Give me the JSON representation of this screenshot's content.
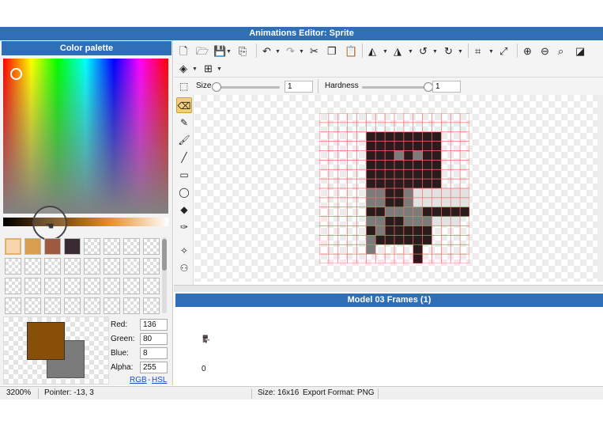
{
  "window": {
    "title": "Animations Editor: Sprite"
  },
  "palette": {
    "title": "Color palette",
    "swatches": [
      {
        "color": "#f6d6ac",
        "selected": true
      },
      {
        "color": "#d89e4e"
      },
      {
        "color": "#a05a40"
      },
      {
        "color": "#3a2a32"
      }
    ],
    "primary_color": "#884f08",
    "secondary_color": "#7b7b7b",
    "red_label": "Red:",
    "red": "136",
    "green_label": "Green:",
    "green": "80",
    "blue_label": "Blue:",
    "blue": "8",
    "alpha_label": "Alpha:",
    "alpha": "255",
    "rgb_link": "RGB",
    "separator": "-",
    "hsl_link": "HSL"
  },
  "options": {
    "size_label": "Size",
    "size_value": "1",
    "size_level": 0.0,
    "hardness_label": "Hardness",
    "hardness_value": "1",
    "hardness_level": 1.0
  },
  "frames": {
    "title": "Model 03 Frames (1)",
    "frame_number": "0"
  },
  "status": {
    "zoom": "3200%",
    "pointer": "Pointer: -13, 3",
    "size": "Size: 16x16",
    "export_format": "Export Format: PNG"
  },
  "colors": {
    "accent": "#2f6fb6",
    "active_tool": "#f3cf7b",
    "grid_line": "#ff6b6b"
  },
  "sprite": {
    "palette": {
      "0": "transparent",
      "1": "#2a1b1c",
      "2": "#7b7b7b",
      "3": "#e2e2e2"
    },
    "pixels": [
      "0000000000000000",
      "0000000000000000",
      "0000011111111000",
      "0000011111111000",
      "0000011121211000",
      "0000011111111000",
      "0000011111111000",
      "0000011111111000",
      "0000022112333333",
      "0000022112333333",
      "0000011222211111",
      "0000022112223330",
      "0000012111110000",
      "0000021111110000",
      "0000020000100000",
      "0000000000100000"
    ]
  }
}
